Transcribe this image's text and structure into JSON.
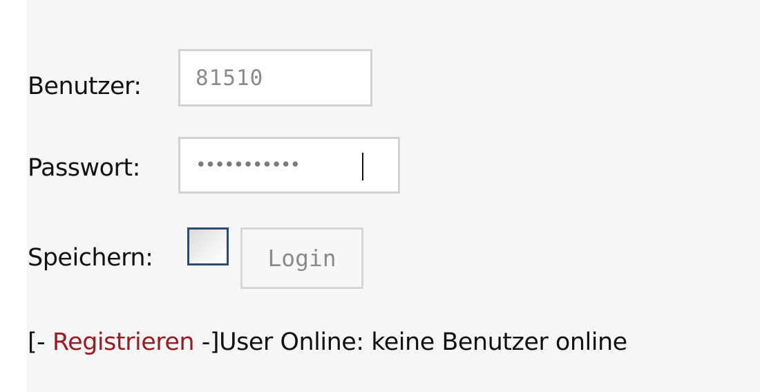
{
  "login_form": {
    "username_label": "Benutzer:",
    "username_value": "81510",
    "password_label": "Passwort:",
    "password_value": "•••••••••••",
    "remember_label": "Speichern:",
    "remember_checked": false,
    "login_button_label": "Login"
  },
  "footer": {
    "bracket_open": "[- ",
    "register_link": "Registrieren",
    "bracket_close": " -]",
    "online_text": "User Online: keine Benutzer online"
  },
  "colors": {
    "panel_background": "#f6f6f6",
    "link": "#9a1b22",
    "input_border": "#d2d2d2",
    "checkbox_border": "#2c4a6b"
  }
}
